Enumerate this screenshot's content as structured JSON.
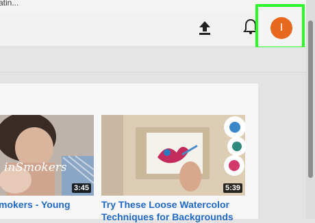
{
  "browser": {
    "partial_url_text": "atin..."
  },
  "header": {
    "upload_icon": "upload-icon",
    "notifications_icon": "bell-icon",
    "avatar_letter": "I",
    "avatar_color": "#e8681e",
    "highlight_color": "#2cff26"
  },
  "videos": [
    {
      "title": "mokers - Young",
      "duration": "3:45",
      "overlay_text": "inSmokers"
    },
    {
      "title_line1": "Try These Loose Watercolor",
      "title_line2": "Techniques for Backgrounds",
      "duration": "5:39"
    }
  ]
}
